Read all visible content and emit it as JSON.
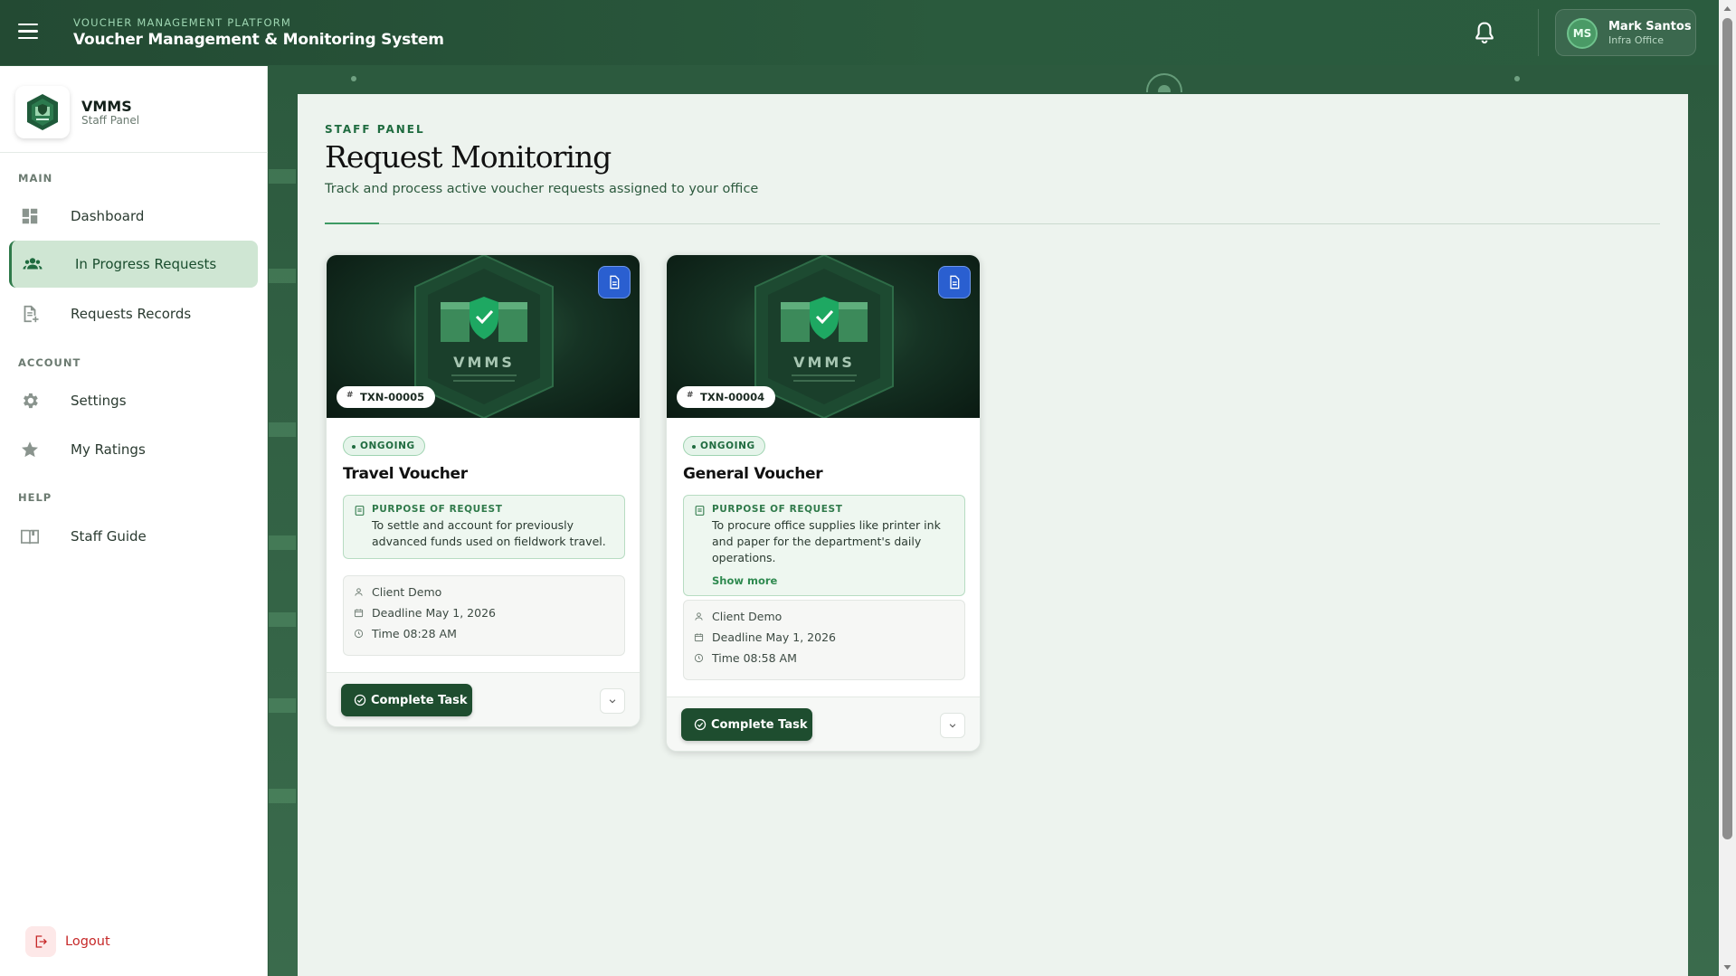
{
  "header": {
    "platform_label": "VOUCHER MANAGEMENT PLATFORM",
    "system_title": "Voucher Management & Monitoring System",
    "user": {
      "initials": "MS",
      "name": "Mark Santos",
      "office": "Infra Office"
    }
  },
  "sidebar": {
    "app_name": "VMMS",
    "app_sub": "Staff Panel",
    "sections": {
      "main": "MAIN",
      "account": "ACCOUNT",
      "help": "HELP"
    },
    "items": [
      {
        "label": "Dashboard",
        "icon": "dashboard-icon",
        "active": false
      },
      {
        "label": "In Progress Requests",
        "icon": "people-icon",
        "active": true
      },
      {
        "label": "Requests Records",
        "icon": "document-add-icon",
        "active": false
      },
      {
        "label": "Settings",
        "icon": "gear-icon",
        "active": false
      },
      {
        "label": "My Ratings",
        "icon": "star-icon",
        "active": false
      },
      {
        "label": "Staff Guide",
        "icon": "book-icon",
        "active": false
      }
    ],
    "logout_label": "Logout"
  },
  "page": {
    "eyebrow": "STAFF PANEL",
    "title": "Request Monitoring",
    "description": "Track and process active voucher requests assigned to your office"
  },
  "cards": [
    {
      "txn": "TXN-00005",
      "status": "ONGOING",
      "title": "Travel Voucher",
      "purpose_label": "PURPOSE OF REQUEST",
      "purpose": "To settle and account for previously advanced funds used on fieldwork travel.",
      "show_more": "",
      "client": "Client Demo",
      "deadline": "Deadline May 1, 2026",
      "time": "Time 08:28 AM",
      "action": "Complete Task",
      "hero_text": "VMMS"
    },
    {
      "txn": "TXN-00004",
      "status": "ONGOING",
      "title": "General Voucher",
      "purpose_label": "PURPOSE OF REQUEST",
      "purpose": "To procure office supplies like printer ink and paper for the department's daily operations.",
      "show_more": "Show more",
      "client": "Client Demo",
      "deadline": "Deadline May 1, 2026",
      "time": "Time 08:58 AM",
      "action": "Complete Task",
      "hero_text": "VMMS"
    }
  ],
  "colors": {
    "brand_green": "#1e4d2f",
    "accent_green": "#2f7a4a",
    "doc_button_blue": "#2a5fd0",
    "logout_red": "#c62828"
  }
}
